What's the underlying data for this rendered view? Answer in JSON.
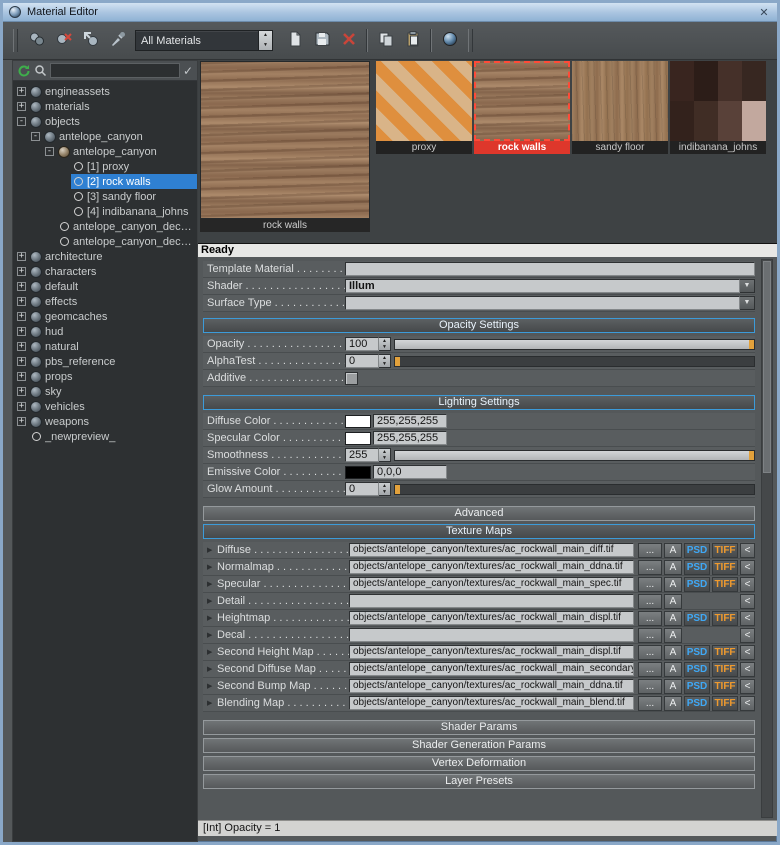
{
  "window": {
    "title": "Material Editor"
  },
  "toolbar": {
    "filter_value": "All Materials"
  },
  "tree_panel": {
    "search_value": ""
  },
  "tree": {
    "items": [
      {
        "label": "engineassets",
        "depth": 0,
        "expander": "+",
        "icon": "lib"
      },
      {
        "label": "materials",
        "depth": 0,
        "expander": "+",
        "icon": "lib"
      },
      {
        "label": "objects",
        "depth": 0,
        "expander": "-",
        "icon": "lib"
      },
      {
        "label": "antelope_canyon",
        "depth": 1,
        "expander": "-",
        "icon": "lib"
      },
      {
        "label": "antelope_canyon",
        "depth": 2,
        "expander": "-",
        "icon": "mtl"
      },
      {
        "label": "[1] proxy",
        "depth": 3,
        "icon": "circle"
      },
      {
        "label": "[2] rock walls",
        "depth": 3,
        "icon": "circle",
        "selected": true
      },
      {
        "label": "[3] sandy floor",
        "depth": 3,
        "icon": "circle"
      },
      {
        "label": "[4] indibanana_johns",
        "depth": 3,
        "icon": "circle"
      },
      {
        "label": "antelope_canyon_decal_...",
        "depth": 2,
        "icon": "circle"
      },
      {
        "label": "antelope_canyon_decal_...",
        "depth": 2,
        "icon": "circle"
      },
      {
        "label": "architecture",
        "depth": 0,
        "expander": "+",
        "icon": "lib"
      },
      {
        "label": "characters",
        "depth": 0,
        "expander": "+",
        "icon": "lib"
      },
      {
        "label": "default",
        "depth": 0,
        "expander": "+",
        "icon": "lib"
      },
      {
        "label": "effects",
        "depth": 0,
        "expander": "+",
        "icon": "lib"
      },
      {
        "label": "geomcaches",
        "depth": 0,
        "expander": "+",
        "icon": "lib"
      },
      {
        "label": "hud",
        "depth": 0,
        "expander": "+",
        "icon": "lib"
      },
      {
        "label": "natural",
        "depth": 0,
        "expander": "+",
        "icon": "lib"
      },
      {
        "label": "pbs_reference",
        "depth": 0,
        "expander": "+",
        "icon": "lib"
      },
      {
        "label": "props",
        "depth": 0,
        "expander": "+",
        "icon": "lib"
      },
      {
        "label": "sky",
        "depth": 0,
        "expander": "+",
        "icon": "lib"
      },
      {
        "label": "vehicles",
        "depth": 0,
        "expander": "+",
        "icon": "lib"
      },
      {
        "label": "weapons",
        "depth": 0,
        "expander": "+",
        "icon": "lib"
      },
      {
        "label": "_newpreview_",
        "depth": 0,
        "icon": "circle"
      }
    ]
  },
  "preview": {
    "caption": "rock walls"
  },
  "thumbnails": [
    {
      "label": "proxy",
      "tex": "proxy"
    },
    {
      "label": "rock walls",
      "tex": "rock",
      "selected": true
    },
    {
      "label": "sandy floor",
      "tex": "sand"
    },
    {
      "label": "indibanana_johns",
      "tex": "dark"
    }
  ],
  "status": {
    "ready": "Ready",
    "info": "[Int] Opacity = 1"
  },
  "props": {
    "template_material": {
      "label": "Template Material . . . . . . . . . . .",
      "value": ""
    },
    "shader": {
      "label": "Shader . . . . . . . . . . . . . . . . . . .",
      "value": "Illum"
    },
    "surface_type": {
      "label": "Surface Type . . . . . . . . . . . . .",
      "value": ""
    },
    "opacity": {
      "label": "Opacity . . . . . . . . . . . . . . . . .",
      "value": "100",
      "percent": 100
    },
    "alphatest": {
      "label": "AlphaTest . . . . . . . . . . . . . . .",
      "value": "0",
      "percent": 0
    },
    "additive": {
      "label": "Additive . . . . . . . . . . . . . . . .",
      "checked": false
    },
    "diffuse_color": {
      "label": "Diffuse Color . . . . . . . . . . . . .",
      "value": "255,255,255",
      "swatch": "#ffffff"
    },
    "specular_color": {
      "label": "Specular Color . . . . . . . . . . .",
      "value": "255,255,255",
      "swatch": "#ffffff"
    },
    "smoothness": {
      "label": "Smoothness . . . . . . . . . . . . .",
      "value": "255",
      "percent": 100
    },
    "emissive_color": {
      "label": "Emissive Color . . . . . . . . . . .",
      "value": "0,0,0",
      "swatch": "#000000"
    },
    "glow_amount": {
      "label": "Glow Amount . . . . . . . . . . . .",
      "value": "0",
      "percent": 0
    },
    "groups": {
      "opacity": "Opacity Settings",
      "lighting": "Lighting Settings",
      "advanced": "Advanced",
      "texture_maps": "Texture Maps",
      "shader_params": "Shader Params",
      "shader_generation_params": "Shader Generation Params",
      "vertex_deformation": "Vertex Deformation",
      "layer_presets": "Layer Presets"
    }
  },
  "texture_maps": {
    "buttons": {
      "browse": "...",
      "alpha": "A",
      "psd": "PSD",
      "tiff": "TIFF",
      "back": "<"
    },
    "rows": [
      {
        "label": "Diffuse . . . . . . . . . . . . . . . .",
        "path": "objects/antelope_canyon/textures/ac_rockwall_main_diff.tif",
        "psd": true,
        "tiff": true
      },
      {
        "label": "Normalmap . . . . . . . . . . . . .",
        "path": "objects/antelope_canyon/textures/ac_rockwall_main_ddna.tif",
        "psd": true,
        "tiff": true
      },
      {
        "label": "Specular . . . . . . . . . . . . . . .",
        "path": "objects/antelope_canyon/textures/ac_rockwall_main_spec.tif",
        "psd": true,
        "tiff": true
      },
      {
        "label": "Detail . . . . . . . . . . . . . . . . .",
        "path": "",
        "psd": false,
        "tiff": false
      },
      {
        "label": "Heightmap . . . . . . . . . . . . .",
        "path": "objects/antelope_canyon/textures/ac_rockwall_main_displ.tif",
        "psd": true,
        "tiff": true
      },
      {
        "label": "Decal . . . . . . . . . . . . . . . . .",
        "path": "",
        "psd": false,
        "tiff": false
      },
      {
        "label": "Second Height Map . . . . . . . .",
        "path": "objects/antelope_canyon/textures/ac_rockwall_main_displ.tif",
        "psd": true,
        "tiff": true
      },
      {
        "label": "Second Diffuse Map . . . . . . . .",
        "path": "objects/antelope_canyon/textures/ac_rockwall_main_secondary_",
        "psd": true,
        "tiff": true
      },
      {
        "label": "Second Bump Map . . . . . . . .",
        "path": "objects/antelope_canyon/textures/ac_rockwall_main_ddna.tif",
        "psd": true,
        "tiff": true
      },
      {
        "label": "Blending Map . . . . . . . . . . . .",
        "path": "objects/antelope_canyon/textures/ac_rockwall_main_blend.tif",
        "psd": true,
        "tiff": true
      }
    ]
  },
  "colors": {
    "selection_blue": "#2f80d2",
    "selected_thumb_red": "#de372b",
    "psd_blue": "#3fa8f5",
    "tiff_orange": "#ef9a2e",
    "slider_handle_orange": "#e2a13b",
    "header_border_blue": "#3c9bd9"
  }
}
